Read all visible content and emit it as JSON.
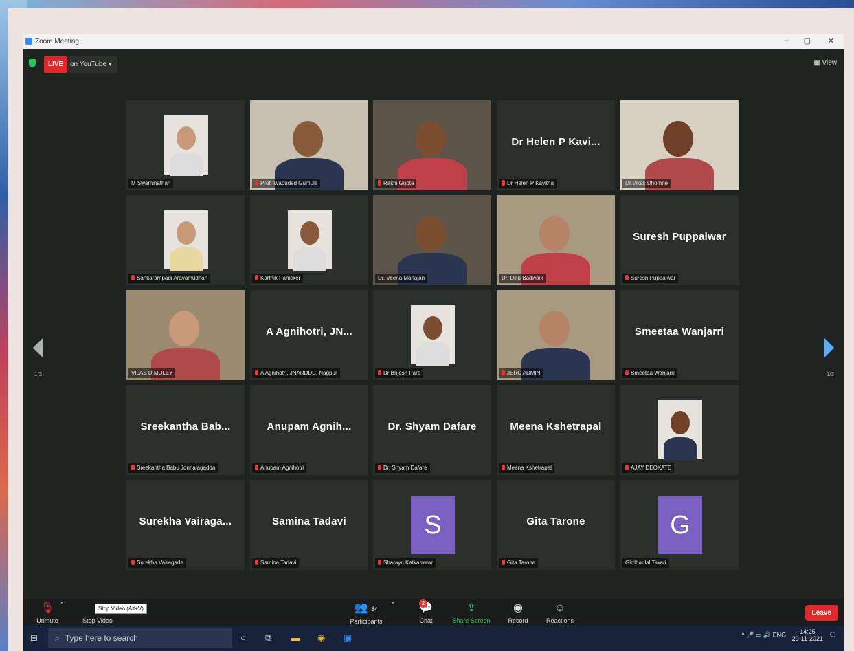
{
  "window": {
    "title": "Zoom Meeting"
  },
  "top_bar": {
    "live_label": "LIVE",
    "live_on": "on YouTube",
    "view_label": "View"
  },
  "page_indicator": {
    "left": "1/3",
    "right": "1/3"
  },
  "tiles": [
    {
      "label": "M Swaminathan",
      "type": "photo",
      "muted": false
    },
    {
      "label": "Prof. Waouded Gumule",
      "type": "video",
      "muted": true
    },
    {
      "label": "Rakhi Gupta",
      "type": "video",
      "muted": true
    },
    {
      "label": "Dr Helen P Kavitha",
      "display": "Dr Helen P Kavi...",
      "type": "name",
      "muted": true
    },
    {
      "label": "Dr.Vikas Dhomne",
      "type": "video",
      "muted": false,
      "active": true
    },
    {
      "label": "Sankarampadi Aravamudhan",
      "type": "photo",
      "muted": true
    },
    {
      "label": "Karthik Panicker",
      "type": "photo",
      "muted": true
    },
    {
      "label": "Dr. Veena Mahajan",
      "type": "video",
      "muted": false
    },
    {
      "label": "Dr. Dilip Badwaik",
      "type": "video",
      "muted": false
    },
    {
      "label": "Suresh Puppalwar",
      "display": "Suresh Puppalwar",
      "type": "name",
      "muted": true
    },
    {
      "label": "VILAS D MULEY",
      "type": "video",
      "muted": false
    },
    {
      "label": "A Agnihotri, JNARDDC, Nagpur",
      "display": "A Agnihotri, JN...",
      "type": "name",
      "muted": true
    },
    {
      "label": "Dr Brijesh Pare",
      "type": "photo",
      "muted": true
    },
    {
      "label": "JERC ADMIN",
      "type": "video",
      "muted": true
    },
    {
      "label": "Smeetaa Wanjarri",
      "display": "Smeetaa Wanjarri",
      "type": "name",
      "muted": true
    },
    {
      "label": "Sreekantha Babu Jonnalagadda",
      "display": "Sreekantha Bab...",
      "type": "name",
      "muted": true
    },
    {
      "label": "Anupam Agnihotri",
      "display": "Anupam Agnih...",
      "type": "name",
      "muted": true
    },
    {
      "label": "Dr. Shyam Dafare",
      "display": "Dr. Shyam Dafare",
      "type": "name",
      "muted": true
    },
    {
      "label": "Meena Kshetrapal",
      "display": "Meena Kshetrapal",
      "type": "name",
      "muted": true
    },
    {
      "label": "AJAY DEOKATE",
      "type": "photo",
      "muted": true
    },
    {
      "label": "Surekha Vairagade",
      "display": "Surekha Vairaga...",
      "type": "name",
      "muted": true
    },
    {
      "label": "Samina Tadavi",
      "display": "Samina Tadavi",
      "type": "name",
      "muted": true
    },
    {
      "label": "Sharayu Katkamwar",
      "letter": "S",
      "type": "letter",
      "muted": true
    },
    {
      "label": "Gita Tarone",
      "display": "Gita Tarone",
      "type": "name",
      "muted": true
    },
    {
      "label": "Girdharilal Tiwari",
      "letter": "G",
      "type": "letter",
      "muted": false
    }
  ],
  "toolbar": {
    "unmute": "Unmute",
    "stop_video": "Stop Video",
    "tooltip": "Stop Video (Alt+V)",
    "participants": "Participants",
    "participants_count": "34",
    "chat": "Chat",
    "chat_badge": "2",
    "share": "Share Screen",
    "record": "Record",
    "reactions": "Reactions",
    "leave": "Leave"
  },
  "taskbar": {
    "search_placeholder": "Type here to search",
    "tray_lang": "ENG",
    "time": "14:25",
    "date": "29-11-2021"
  },
  "colors": {
    "live_red": "#e02828",
    "active_border": "#e3cf3c",
    "share_green": "#23c55e",
    "avatar_purple": "#7a60c0"
  }
}
